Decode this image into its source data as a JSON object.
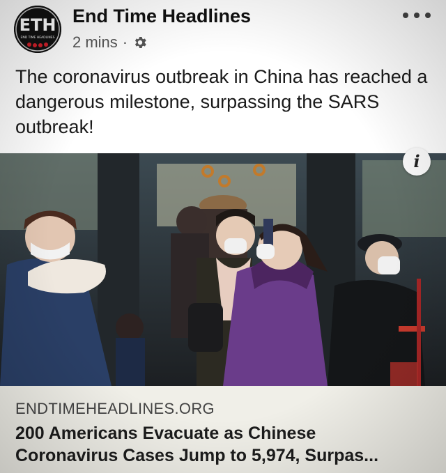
{
  "post": {
    "page_name": "End Time Headlines",
    "avatar_text": "ETH",
    "avatar_subtext": "END TIME HEADLINES",
    "time": "2 mins",
    "separator": "·",
    "privacy_icon": "gear-icon",
    "menu_icon": "more-options-icon",
    "caption": "The coronavirus outbreak in China has reached a dangerous milestone, surpassing the SARS outbreak!"
  },
  "link": {
    "info_icon_label": "i",
    "domain": "ENDTIMEHEADLINES.ORG",
    "title_line1": "200 Americans Evacuate as Chinese",
    "title_line2": "Coronavirus Cases Jump to 5,974, Surpas..."
  },
  "colors": {
    "photo_coat_purple": "#6a3c8a",
    "photo_coat_blue": "#2a3f66",
    "link_box_bg": "#f0efe8"
  }
}
